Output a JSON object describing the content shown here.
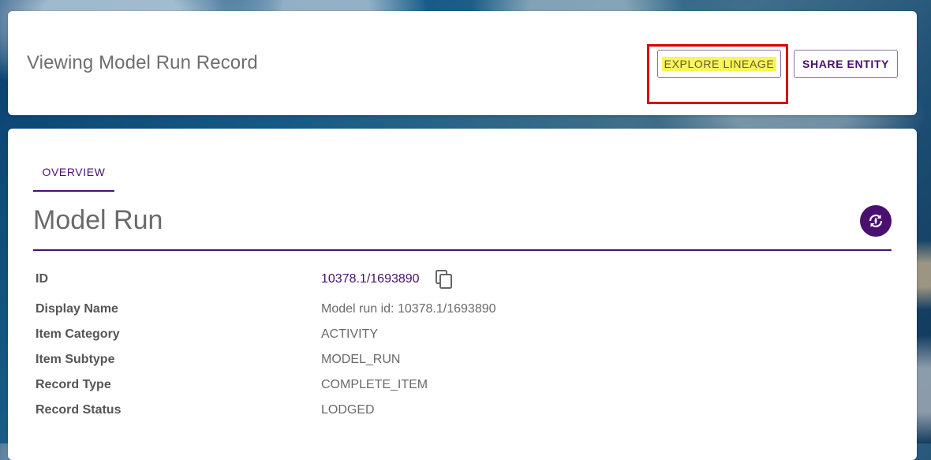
{
  "header": {
    "title": "Viewing Model Run Record",
    "explore_lineage_label": "EXPLORE LINEAGE",
    "share_entity_label": "SHARE ENTITY"
  },
  "tabs": [
    {
      "label": "OVERVIEW"
    }
  ],
  "section": {
    "title": "Model Run",
    "icon": "model-run-icon"
  },
  "fields": {
    "id": {
      "label": "ID",
      "value": "10378.1/1693890",
      "copy_icon": "copy-icon"
    },
    "display_name": {
      "label": "Display Name",
      "value": "Model run id: 10378.1/1693890"
    },
    "item_category": {
      "label": "Item Category",
      "value": "ACTIVITY"
    },
    "item_subtype": {
      "label": "Item Subtype",
      "value": "MODEL_RUN"
    },
    "record_type": {
      "label": "Record Type",
      "value": "COMPLETE_ITEM"
    },
    "record_status": {
      "label": "Record Status",
      "value": "LODGED"
    }
  },
  "colors": {
    "accent": "#4a1070",
    "highlight": "#f9f55a",
    "annotation_frame": "#d80000"
  }
}
